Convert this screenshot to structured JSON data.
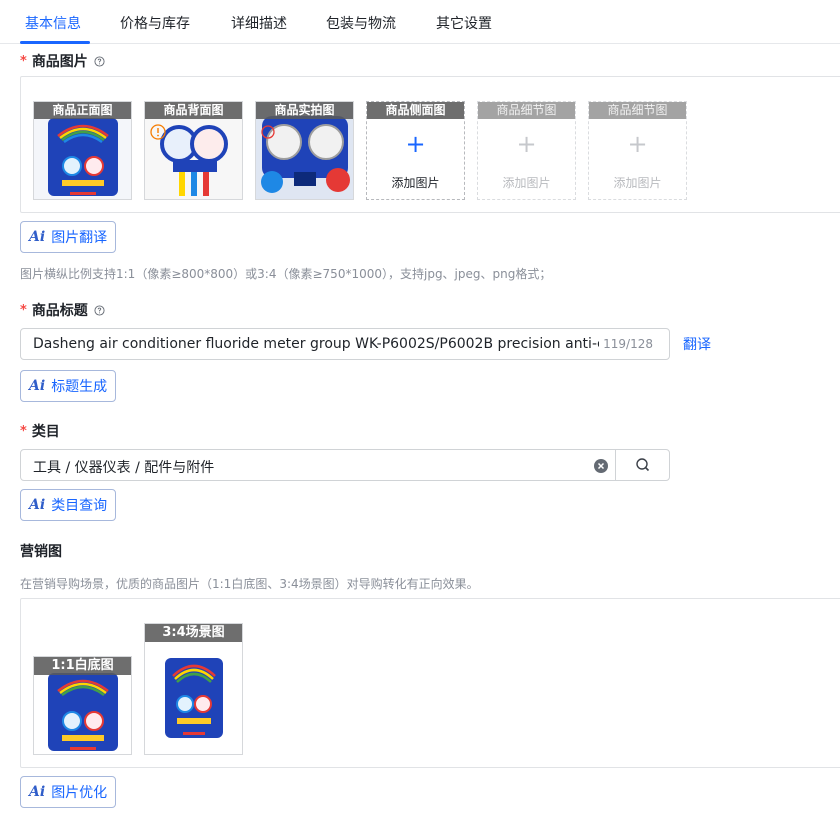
{
  "tabs": [
    {
      "label": "基本信息",
      "active": true
    },
    {
      "label": "价格与库存",
      "active": false
    },
    {
      "label": "详细描述",
      "active": false
    },
    {
      "label": "包装与物流",
      "active": false
    },
    {
      "label": "其它设置",
      "active": false
    }
  ],
  "product_images": {
    "label": "商品图片",
    "required": "*",
    "slots": [
      {
        "caption": "商品正面图",
        "state": "filled"
      },
      {
        "caption": "商品背面图",
        "state": "filled"
      },
      {
        "caption": "商品实拍图",
        "state": "filled"
      },
      {
        "caption": "商品侧面图",
        "state": "empty",
        "add_text": "添加图片"
      },
      {
        "caption": "商品细节图",
        "state": "disabled",
        "add_text": "添加图片"
      },
      {
        "caption": "商品细节图",
        "state": "disabled",
        "add_text": "添加图片"
      }
    ],
    "ai_button": "图片翻译",
    "hint": "图片横纵比例支持1:1（像素≥800*800）或3:4（像素≥750*1000），支持jpg、jpeg、png格式；"
  },
  "product_title": {
    "label": "商品标题",
    "required": "*",
    "value": "Dasheng air conditioner fluoride meter group WK-P6002S/P6002B  precision anti-collision r",
    "counter": "119/128",
    "translate_link": "翻译",
    "ai_button": "标题生成"
  },
  "category": {
    "label": "类目",
    "required": "*",
    "value": "工具 / 仪器仪表 / 配件与附件",
    "ai_button": "类目查询"
  },
  "marketing": {
    "label": "营销图",
    "hint": "在营销导购场景，优质的商品图片（1:1白底图、3:4场景图）对导购转化有正向效果。",
    "slots": [
      {
        "caption": "1:1白底图"
      },
      {
        "caption": "3:4场景图"
      }
    ],
    "ai_button": "图片优化"
  },
  "colors": {
    "accent": "#1966ff",
    "required": "#f54a45",
    "case_blue": "#1f43b8"
  },
  "icons": {
    "help": "help-circle-icon",
    "ai": "ai-sparkle-icon",
    "clear": "clear-circle-icon",
    "search": "search-icon",
    "plus": "plus-icon"
  }
}
